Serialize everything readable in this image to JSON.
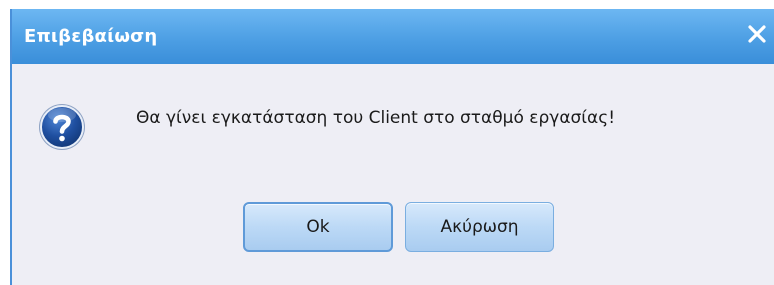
{
  "dialog": {
    "title": "Επιβεβαίωση",
    "close_icon": "close-icon",
    "icon": "question-icon",
    "message": "Θα γίνει εγκατάσταση του Client στο σταθμό εργασίας!",
    "buttons": {
      "ok_label": "Ok",
      "cancel_label": "Ακύρωση"
    }
  },
  "colors": {
    "titlebar": "#4d9fe4",
    "body_background": "#eeeef5",
    "button_fill": "#bcd9f6",
    "icon_fill": "#1f4fa0"
  }
}
